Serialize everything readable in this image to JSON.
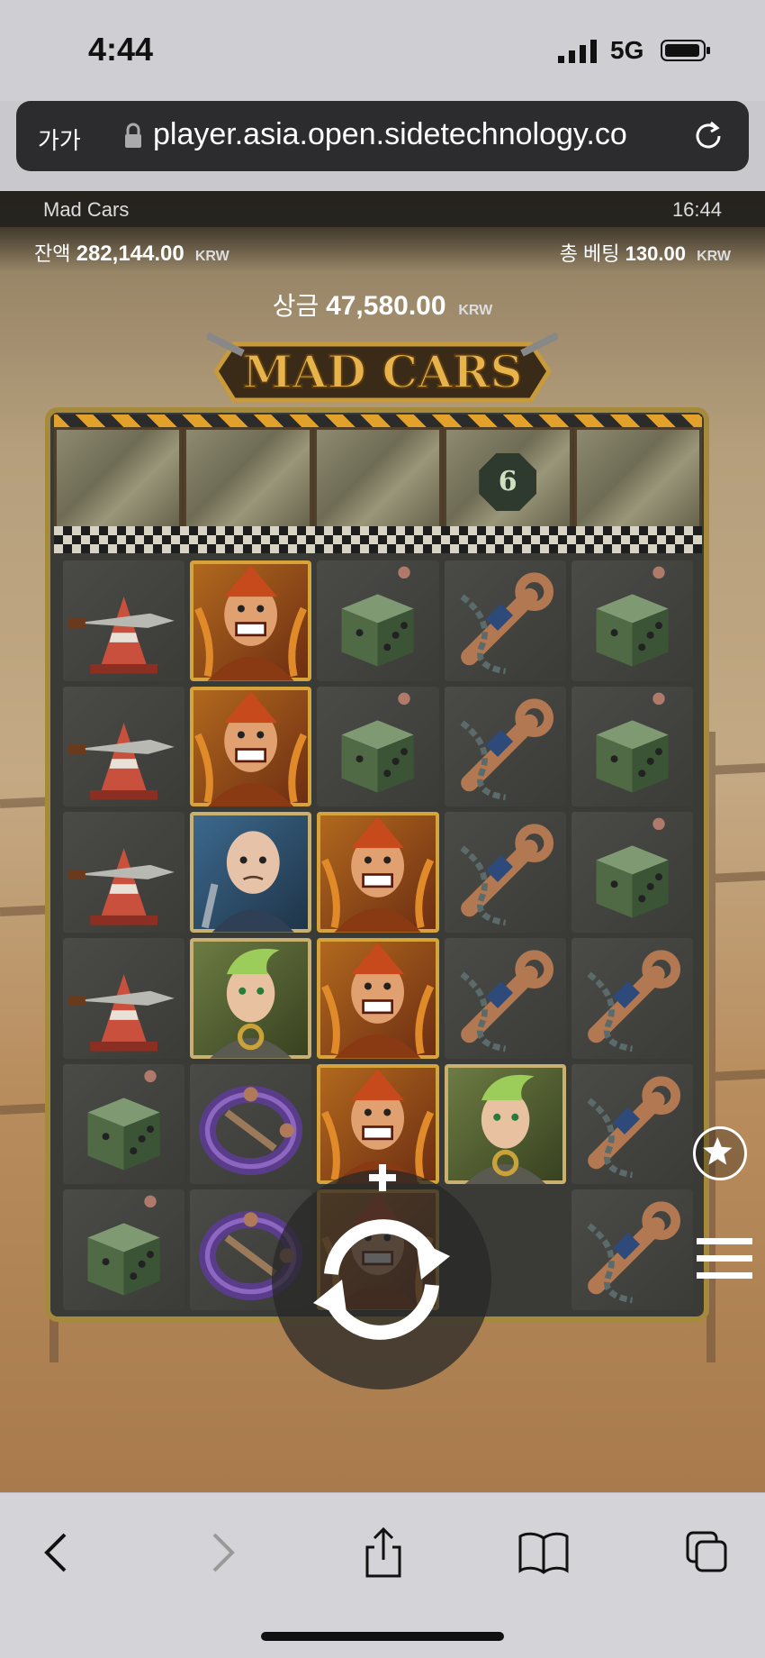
{
  "status": {
    "time": "4:44",
    "network": "5G"
  },
  "browser": {
    "text_size_label": "가가",
    "url": "player.asia.open.sidetechnology.co"
  },
  "game": {
    "title": "Mad Cars",
    "clock": "16:44",
    "balance_label": "잔액",
    "balance_value": "282,144.00",
    "currency": "KRW",
    "bet_label": "총 베팅",
    "bet_value": "130.00",
    "win_label": "상금",
    "win_value": "47,580.00",
    "logo_text": "MAD CARS",
    "header_multiplier": "6",
    "reels": [
      [
        "cone-knife",
        "cone-knife",
        "cone-knife",
        "cone-knife",
        "dice",
        "dice"
      ],
      [
        "villain",
        "villain",
        "bald-man",
        "green-hair-woman",
        "purple-ring",
        "purple-ring"
      ],
      [
        "dice",
        "dice",
        "villain",
        "villain",
        "villain",
        "villain"
      ],
      [
        "wrench-chain",
        "wrench-chain",
        "wrench-chain",
        "wrench-chain",
        "green-hair-woman",
        "empty"
      ],
      [
        "dice",
        "dice",
        "dice",
        "wrench-chain",
        "wrench-chain",
        "wrench-chain"
      ]
    ]
  },
  "colors": {
    "accent_gold": "#d6a43a",
    "frame": "#a68a3c",
    "browser_bar": "#2c2c2e"
  }
}
